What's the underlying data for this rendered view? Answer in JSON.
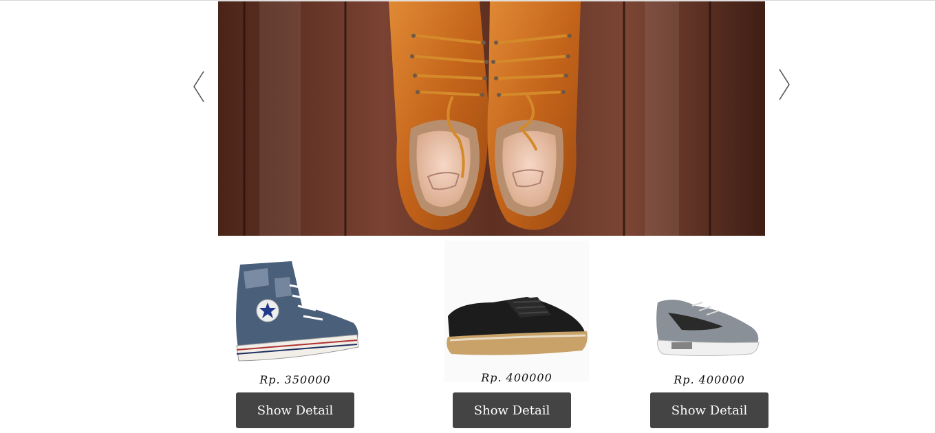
{
  "carousel": {
    "prev_icon": "chevron-left-icon",
    "next_icon": "chevron-right-icon",
    "slide_description_icon": "hero-image"
  },
  "products": [
    {
      "price": "Rp. 350000",
      "button_label": "Show Detail"
    },
    {
      "price": "Rp. 400000",
      "button_label": "Show Detail"
    },
    {
      "price": "Rp. 400000",
      "button_label": "Show Detail"
    }
  ],
  "colors": {
    "button_bg": "#444444",
    "button_text": "#ffffff",
    "wood": "#5a2e1c",
    "leather": "#c86a1f"
  }
}
